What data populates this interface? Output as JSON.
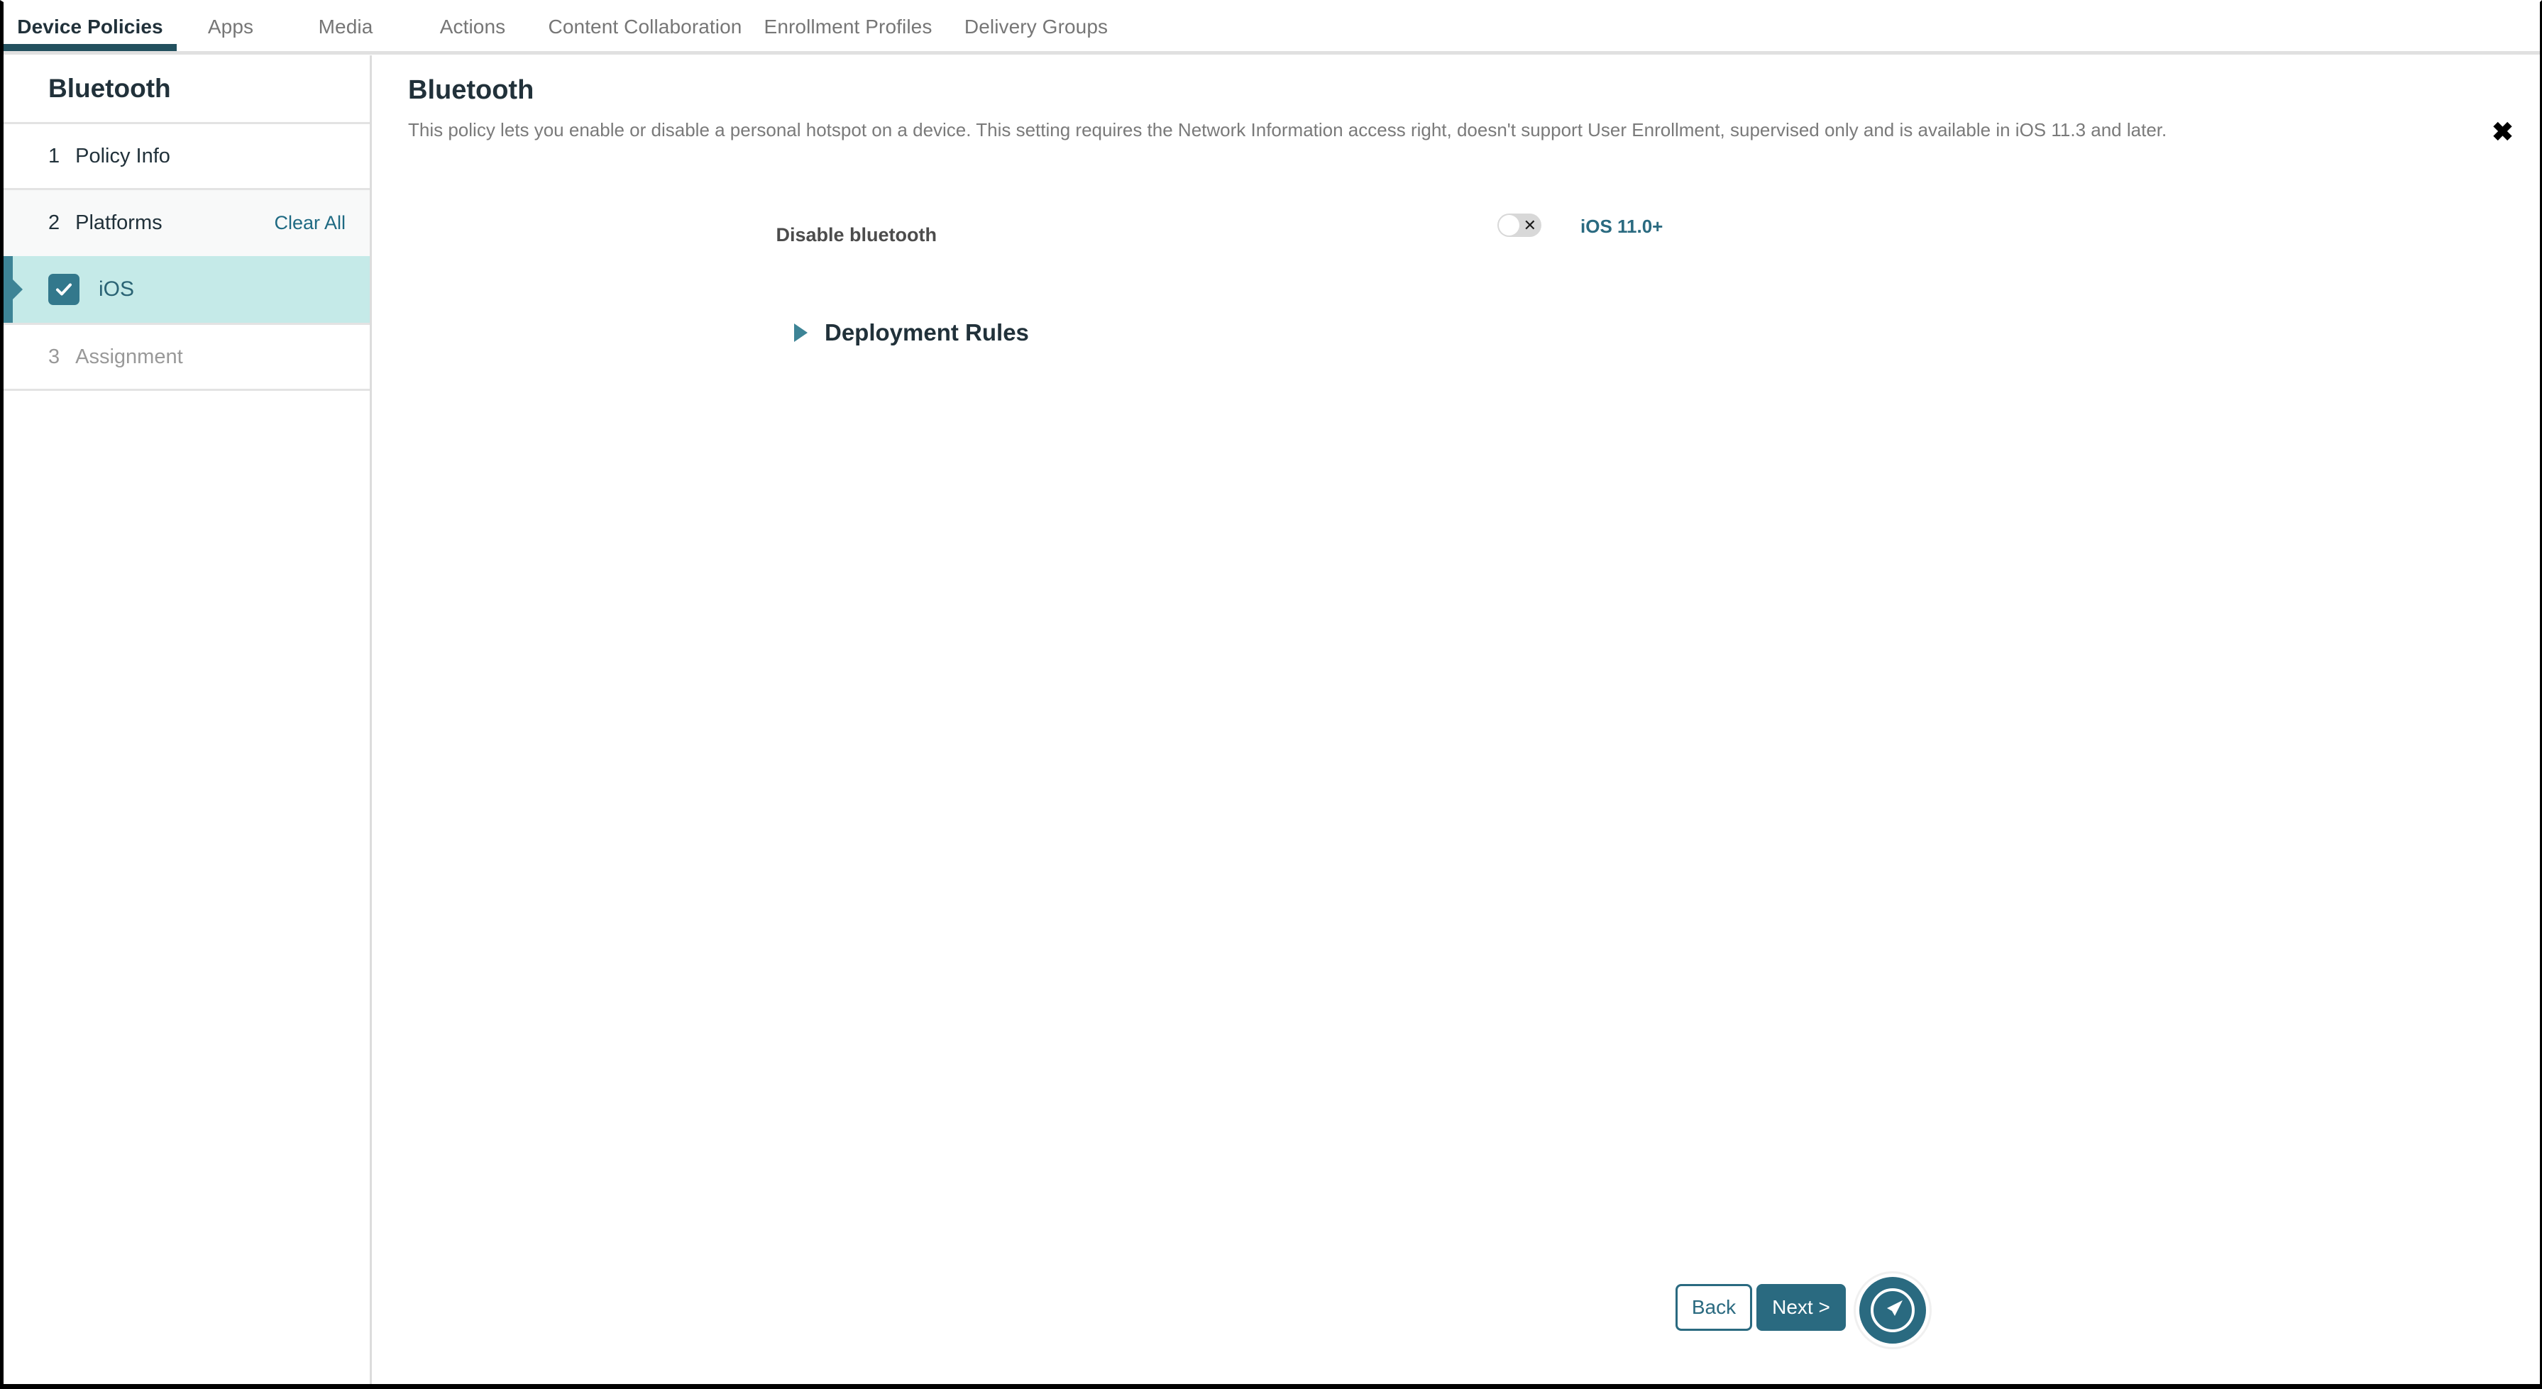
{
  "nav": {
    "tabs": [
      {
        "label": "Device Policies",
        "active": true
      },
      {
        "label": "Apps",
        "active": false
      },
      {
        "label": "Media",
        "active": false
      },
      {
        "label": "Actions",
        "active": false
      },
      {
        "label": "Content Collaboration",
        "active": false
      },
      {
        "label": "Enrollment Profiles",
        "active": false
      },
      {
        "label": "Delivery Groups",
        "active": false
      }
    ]
  },
  "sidebar": {
    "title": "Bluetooth",
    "steps": [
      {
        "number": "1",
        "label": "Policy Info"
      },
      {
        "number": "2",
        "label": "Platforms",
        "action": "Clear All"
      },
      {
        "number": "3",
        "label": "Assignment"
      }
    ],
    "clear_all_label": "Clear All",
    "platforms": [
      {
        "label": "iOS",
        "checked": true,
        "selected": true
      }
    ]
  },
  "main": {
    "title": "Bluetooth",
    "description": "This policy lets you enable or disable a personal hotspot on a device. This setting requires the Network Information access right, doesn't support User Enrollment, supervised only and is available in iOS 11.3 and later.",
    "close_label": "✖",
    "setting": {
      "label": "Disable bluetooth",
      "toggle_state": "off",
      "toggle_mark": "✕",
      "version_note": "iOS 11.0+"
    },
    "section": {
      "label": "Deployment Rules",
      "expanded": false
    }
  },
  "footer": {
    "back_label": "Back",
    "next_label": "Next >"
  },
  "colors": {
    "accent_teal": "#2a6a80",
    "active_tab_underline": "#22505e",
    "selected_row_bg": "#c5eae8",
    "checkbox_fill": "#33788c",
    "link_teal": "#1f6a83",
    "muted_text": "#767676"
  }
}
